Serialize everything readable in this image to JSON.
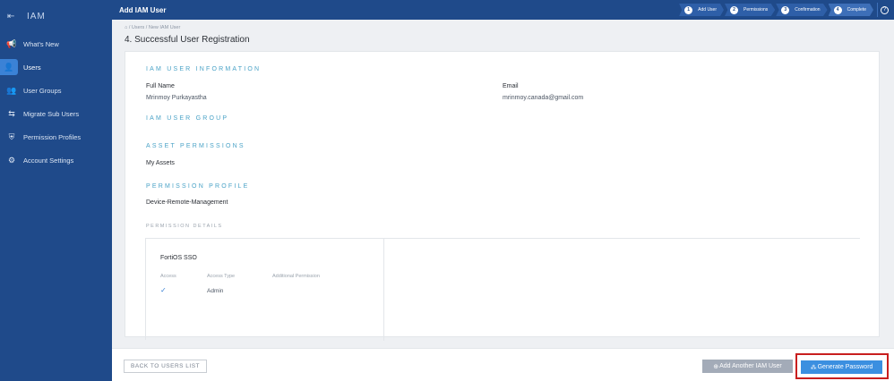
{
  "sidebar": {
    "title": "IAM",
    "header_icon": "collapse-menu-icon",
    "items": [
      {
        "label": "What's New",
        "icon": "megaphone-icon",
        "glyph": "📢"
      },
      {
        "label": "Users",
        "icon": "user-icon",
        "glyph": "👤",
        "active": true
      },
      {
        "label": "User Groups",
        "icon": "user-group-icon",
        "glyph": "👥"
      },
      {
        "label": "Migrate Sub Users",
        "icon": "migrate-icon",
        "glyph": "⇆"
      },
      {
        "label": "Permission Profiles",
        "icon": "shield-icon",
        "glyph": "⛨"
      },
      {
        "label": "Account Settings",
        "icon": "gear-icon",
        "glyph": "⚙"
      }
    ]
  },
  "topbar": {
    "title": "Add IAM User",
    "help": "?",
    "steps": [
      {
        "num": "1",
        "label": "Add User"
      },
      {
        "num": "2",
        "label": "Permissions"
      },
      {
        "num": "3",
        "label": "Confirmation"
      },
      {
        "num": "4",
        "label": "Complete"
      }
    ]
  },
  "breadcrumb": "⌂ / Users / New IAM User",
  "page_title": "4. Successful User Registration",
  "info": {
    "section_title": "IAM USER INFORMATION",
    "full_name_label": "Full Name",
    "full_name": "Mrinmoy Purkayastha",
    "email_label": "Email",
    "email": "mrinmoy.canada@gmail.com"
  },
  "group_section_title": "IAM USER GROUP",
  "asset": {
    "section_title": "ASSET PERMISSIONS",
    "value": "My Assets"
  },
  "profile": {
    "section_title": "PERMISSION PROFILE",
    "value": "Device-Remote-Management"
  },
  "details": {
    "title": "PERMISSION DETAILS",
    "product": "FortiOS SSO",
    "col_access": "Access",
    "col_type": "Access Type",
    "col_additional": "Additional Permission",
    "check": "✓",
    "access_type": "Admin"
  },
  "footer": {
    "back": "BACK TO USERS LIST",
    "add": "Add Another IAM User",
    "add_icon": "add-user-icon",
    "generate": "Generate Password",
    "generate_icon": "people-icon",
    "highlight_color": "#c81e1e"
  }
}
